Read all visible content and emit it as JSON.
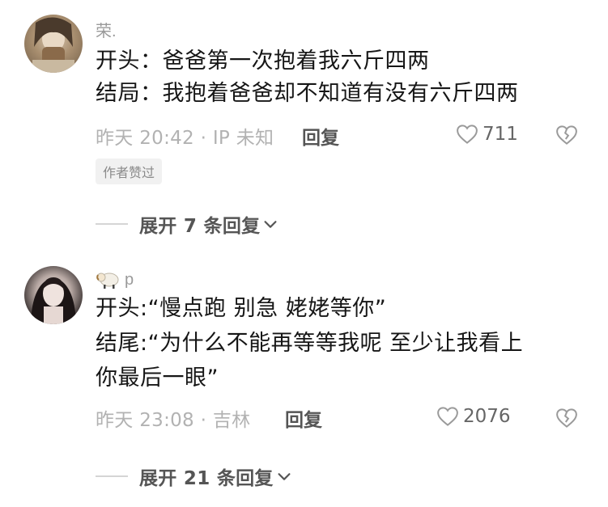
{
  "comments": [
    {
      "username": "荣.",
      "lines": [
        "开头：爸爸第一次抱着我六斤四两",
        "结局：我抱着爸爸却不知道有没有六斤四两"
      ],
      "meta": "昨天 20:42 · IP 未知",
      "reply_label": "回复",
      "likes": "711",
      "author_tag": "作者赞过",
      "expand_label": "展开 7 条回复"
    },
    {
      "username": "p",
      "username_icon": "sheep-emoji-icon",
      "lines": [
        "开头:“慢点跑  别急 姥姥等你”",
        "结尾:“为什么不能再等等我呢 至少让我看上",
        "你最后一眼”"
      ],
      "meta": "昨天 23:08 · 吉林",
      "reply_label": "回复",
      "likes": "2076",
      "expand_label": "展开 21 条回复"
    }
  ],
  "colors": {
    "text_primary": "#161616",
    "text_secondary": "#b2b2b2",
    "accent_dark": "#555555"
  }
}
